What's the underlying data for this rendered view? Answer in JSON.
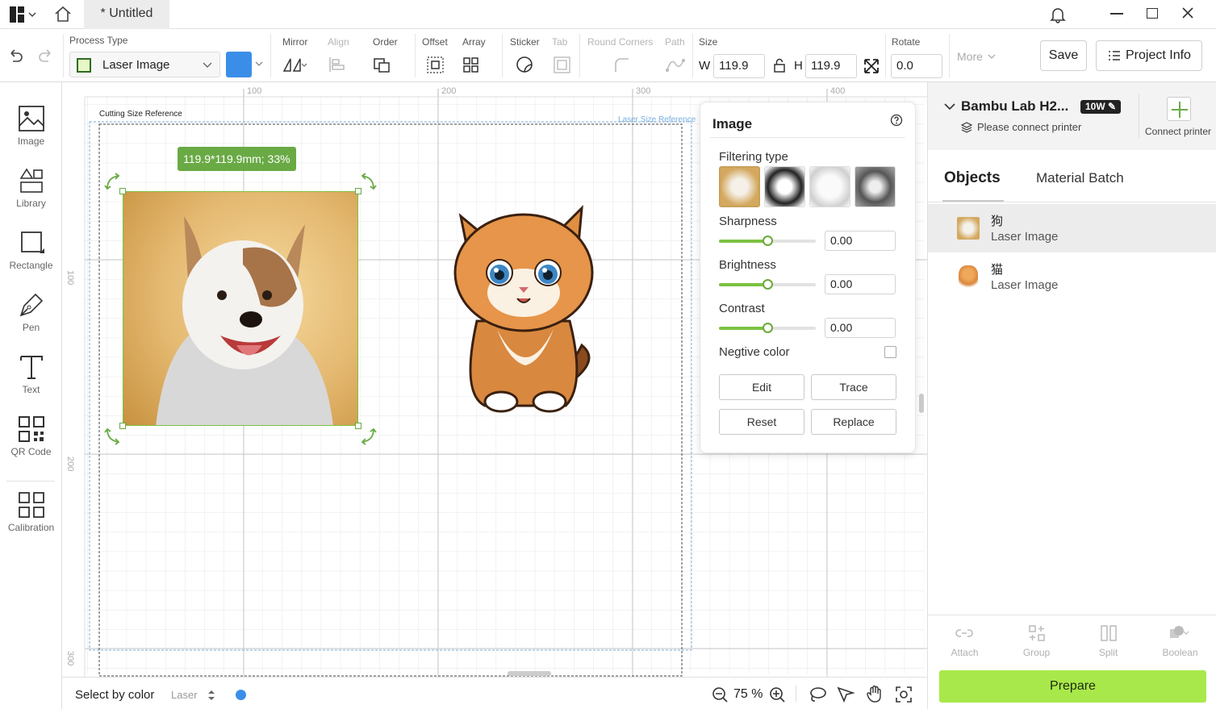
{
  "titlebar": {
    "tab_title": "* Untitled"
  },
  "toolbar": {
    "process_type_label": "Process Type",
    "process_type_value": "Laser Image",
    "mirror": "Mirror",
    "align": "Align",
    "order": "Order",
    "offset": "Offset",
    "array": "Array",
    "sticker": "Sticker",
    "tab": "Tab",
    "round_corners": "Round Corners",
    "path": "Path",
    "size_label": "Size",
    "w_label": "W",
    "w_value": "119.9",
    "h_label": "H",
    "h_value": "119.9",
    "rotate_label": "Rotate",
    "rotate_value": "0.0",
    "more": "More",
    "save": "Save",
    "project_info": "Project Info",
    "color_swatch": "#3b8ee8"
  },
  "tools": [
    {
      "label": "Image",
      "icon": "image-icon"
    },
    {
      "label": "Library",
      "icon": "library-icon"
    },
    {
      "label": "Rectangle",
      "icon": "rectangle-icon"
    },
    {
      "label": "Pen",
      "icon": "pen-icon"
    },
    {
      "label": "Text",
      "icon": "text-icon"
    },
    {
      "label": "QR Code",
      "icon": "qr-code-icon"
    },
    {
      "label": "Calibration",
      "icon": "calibration-icon"
    }
  ],
  "canvas": {
    "ruler_top": [
      "100",
      "200",
      "300",
      "400"
    ],
    "ruler_left": [
      "100",
      "200",
      "300"
    ],
    "cutting_size_ref": "Cutting Size Reference",
    "laser_size_ref": "Laser Size Reference",
    "size_tooltip": "119.9*119.9mm; 33%"
  },
  "image_panel": {
    "title": "Image",
    "filtering_type": "Filtering type",
    "sharpness": "Sharpness",
    "sharpness_value": "0.00",
    "sharpness_level": 0.5,
    "brightness": "Brightness",
    "brightness_value": "0.00",
    "brightness_level": 0.5,
    "contrast": "Contrast",
    "contrast_value": "0.00",
    "contrast_level": 0.5,
    "negative_color": "Negtive color",
    "edit": "Edit",
    "trace": "Trace",
    "reset": "Reset",
    "replace": "Replace"
  },
  "printer": {
    "name": "Bambu Lab H2...",
    "badge": "10W",
    "status": "Please connect printer",
    "connect": "Connect printer"
  },
  "tabs": {
    "objects": "Objects",
    "material_batch": "Material Batch"
  },
  "objects": [
    {
      "name": "狗",
      "type": "Laser Image"
    },
    {
      "name": "猫",
      "type": "Laser Image"
    }
  ],
  "actions": {
    "attach": "Attach",
    "group": "Group",
    "split": "Split",
    "boolean": "Boolean"
  },
  "prepare": "Prepare",
  "statusbar": {
    "select_by_color": "Select by color",
    "mode": "Laser",
    "zoom": "75 %",
    "dot_color": "#3b8ee8"
  },
  "colors": {
    "accent": "#a9e84a",
    "tooltip": "#6aaa45"
  }
}
